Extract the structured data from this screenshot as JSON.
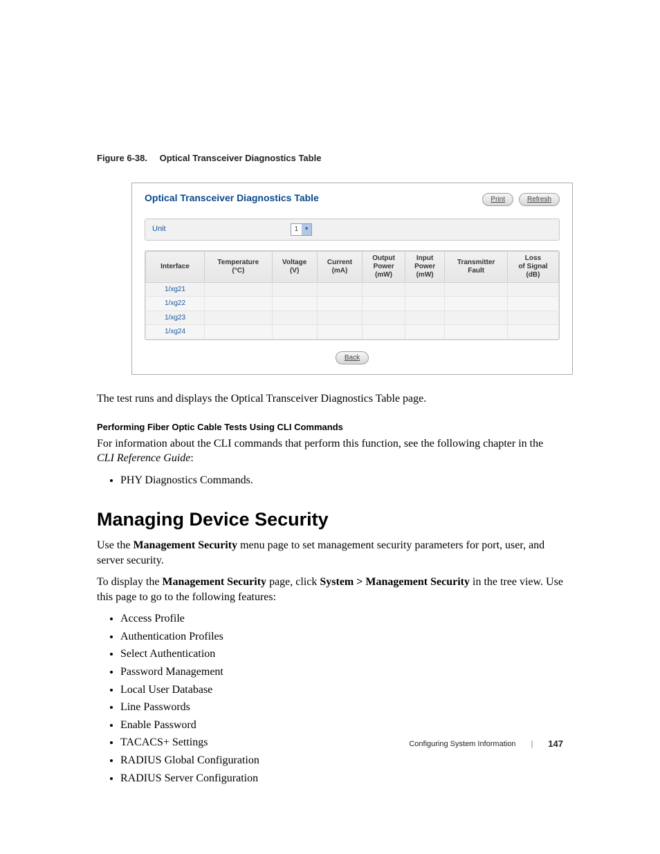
{
  "figure": {
    "number": "Figure 6-38.",
    "title": "Optical Transceiver Diagnostics Table"
  },
  "app": {
    "title": "Optical Transceiver Diagnostics Table",
    "buttons": {
      "print": "Print",
      "refresh": "Refresh"
    },
    "unit": {
      "label": "Unit",
      "value": "1"
    },
    "columns": {
      "interface": "Interface",
      "temperature": "Temperature\n(°C)",
      "voltage": "Voltage\n(V)",
      "current": "Current\n(mA)",
      "output_power": "Output\nPower\n(mW)",
      "input_power": "Input\nPower\n(mW)",
      "tx_fault": "Transmitter\nFault",
      "loss_signal": "Loss\nof Signal\n(dB)"
    },
    "rows": [
      {
        "interface": "1/xg21"
      },
      {
        "interface": "1/xg22"
      },
      {
        "interface": "1/xg23"
      },
      {
        "interface": "1/xg24"
      }
    ],
    "back": "Back"
  },
  "body": {
    "p1": "The test runs and displays the Optical Transceiver Diagnostics Table page.",
    "subhead1": "Performing Fiber Optic Cable Tests Using CLI Commands",
    "p2a": "For information about the CLI commands that perform this function, see the following chapter in the ",
    "p2_italic": "CLI Reference Guide",
    "p2b": ":",
    "phy_item": "PHY Diagnostics Commands.",
    "h2": "Managing Device Security",
    "p3a": "Use the ",
    "p3_bold": "Management Security",
    "p3b": " menu page to set management security parameters for port, user, and server security.",
    "p4a": "To display the ",
    "p4_bold1": "Management Security",
    "p4b": " page, click ",
    "p4_bold2": "System > Management Security",
    "p4c": " in the tree view. Use this page to go to the following features:"
  },
  "features": [
    "Access Profile",
    "Authentication Profiles",
    "Select Authentication",
    "Password Management",
    "Local User Database",
    "Line Passwords",
    "Enable Password",
    "TACACS+ Settings",
    "RADIUS Global Configuration",
    "RADIUS Server Configuration"
  ],
  "footer": {
    "section": "Configuring System Information",
    "page": "147"
  }
}
